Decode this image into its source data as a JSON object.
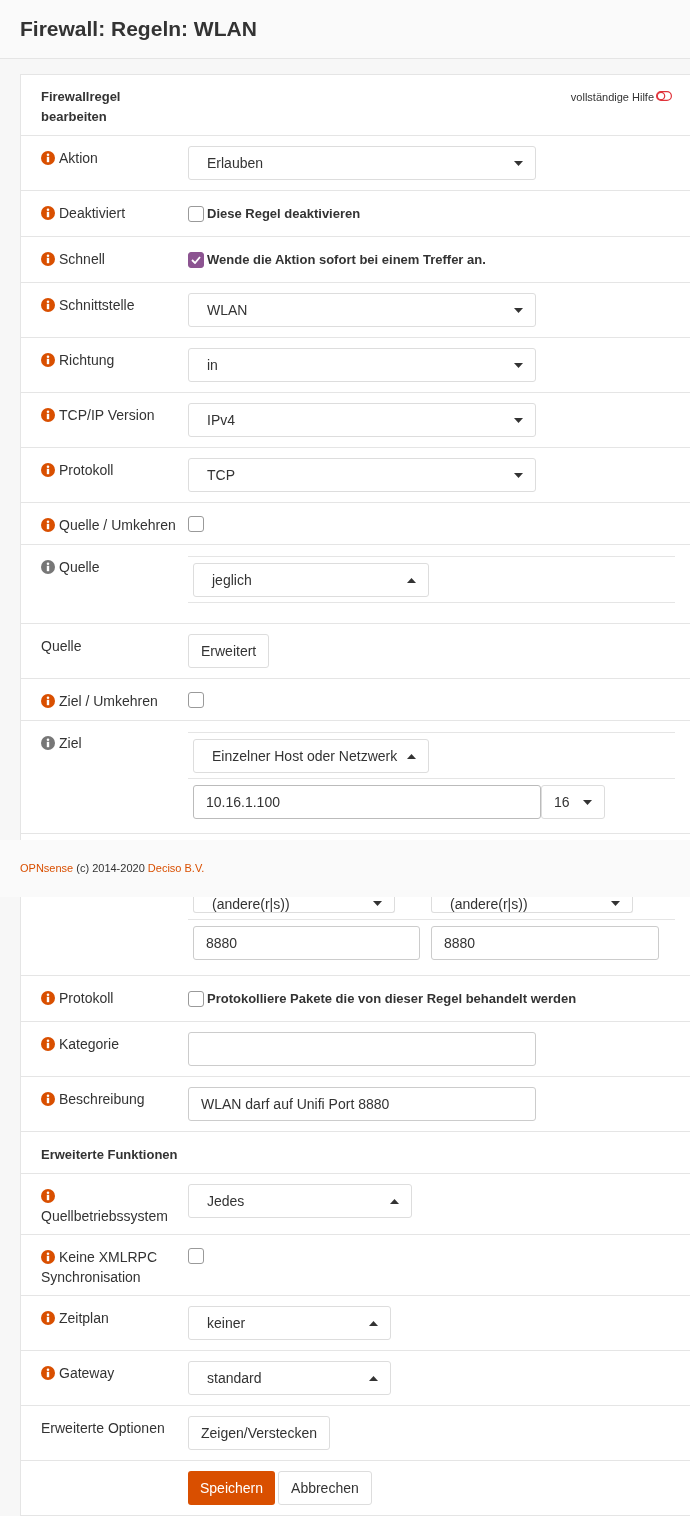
{
  "page_title": "Firewall: Regeln: WLAN",
  "form": {
    "title": "Firewallregel bearbeiten",
    "help_toggle": {
      "label": "vollständige Hilfe",
      "on": false
    }
  },
  "rows": [
    {
      "kind": "select",
      "label": "Aktion",
      "info": {
        "color": "#d94f00"
      },
      "value": "Erlauben",
      "caret_up": false
    },
    {
      "kind": "checkbox",
      "label": "Deaktiviert",
      "info": {
        "color": "#d94f00"
      },
      "checked": false,
      "text": "Diese Regel deaktivieren"
    },
    {
      "kind": "checkbox",
      "label": "Schnell",
      "info": {
        "color": "#d94f00"
      },
      "checked": true,
      "text": "Wende die Aktion sofort bei einem Treffer an."
    },
    {
      "kind": "select",
      "label": "Schnittstelle",
      "info": {
        "color": "#d94f00"
      },
      "value": "WLAN",
      "caret_up": false
    },
    {
      "kind": "select",
      "label": "Richtung",
      "info": {
        "color": "#d94f00"
      },
      "value": "in",
      "caret_up": false
    },
    {
      "kind": "select",
      "label": "TCP/IP Version",
      "info": {
        "color": "#d94f00"
      },
      "value": "IPv4",
      "caret_up": false
    },
    {
      "kind": "select",
      "label": "Protokoll",
      "info": {
        "color": "#d94f00"
      },
      "value": "TCP",
      "caret_up": false
    },
    {
      "kind": "checkbox",
      "label": "Quelle / Umkehren",
      "info": {
        "color": "#d94f00"
      },
      "checked": false
    },
    {
      "kind": "nested-picker",
      "label": "Quelle",
      "info": {
        "color": "#777777"
      },
      "value": "jeglich",
      "caret_up": true
    },
    {
      "kind": "button",
      "label": "Quelle",
      "value": "Erweitert"
    },
    {
      "kind": "checkbox",
      "label": "Ziel / Umkehren",
      "info": {
        "color": "#d94f00"
      },
      "checked": false
    },
    {
      "kind": "address",
      "label": "Ziel",
      "info": {
        "color": "#777777"
      },
      "value": "Einzelner Host oder Netzwerk",
      "caret_up": true,
      "address": "10.16.1.100",
      "mask": "16"
    },
    {
      "kind": "ports",
      "from": {
        "select": "(andere(r|s))",
        "port": "8880"
      },
      "to": {
        "select": "(andere(r|s))",
        "port": "8880"
      }
    },
    {
      "kind": "checkbox",
      "label": "Protokoll",
      "info": {
        "color": "#d94f00"
      },
      "checked": false,
      "text": "Protokolliere Pakete die von dieser Regel behandelt werden"
    },
    {
      "kind": "text",
      "label": "Kategorie",
      "info": {
        "color": "#d94f00"
      }
    },
    {
      "kind": "text",
      "label": "Beschreibung",
      "info": {
        "color": "#d94f00"
      },
      "value": "WLAN darf auf Unifi Port 8880"
    },
    {
      "kind": "heading",
      "label": "Erweiterte Funktionen"
    },
    {
      "kind": "picker",
      "label": "Quellbetriebssystem",
      "info": {
        "color": "#d94f00"
      },
      "value": "Jedes",
      "caret_up": true
    },
    {
      "kind": "checkbox",
      "label": "Keine XMLRPC Synchronisation",
      "info": {
        "color": "#d94f00"
      },
      "checked": false
    },
    {
      "kind": "picker",
      "label": "Zeitplan",
      "info": {
        "color": "#d94f00"
      },
      "value": "keiner",
      "caret_up": true
    },
    {
      "kind": "picker",
      "label": "Gateway",
      "info": {
        "color": "#d94f00"
      },
      "value": "standard",
      "caret_up": true
    },
    {
      "kind": "button",
      "label": "Erweiterte Optionen",
      "value": "Zeigen/Verstecken"
    },
    {
      "kind": "actions",
      "primary": "Speichern",
      "secondary": "Abbrechen"
    }
  ],
  "footer": {
    "brand": "OPNsense",
    "copyright": "(c) 2014-2020",
    "company": "Deciso B.V."
  }
}
